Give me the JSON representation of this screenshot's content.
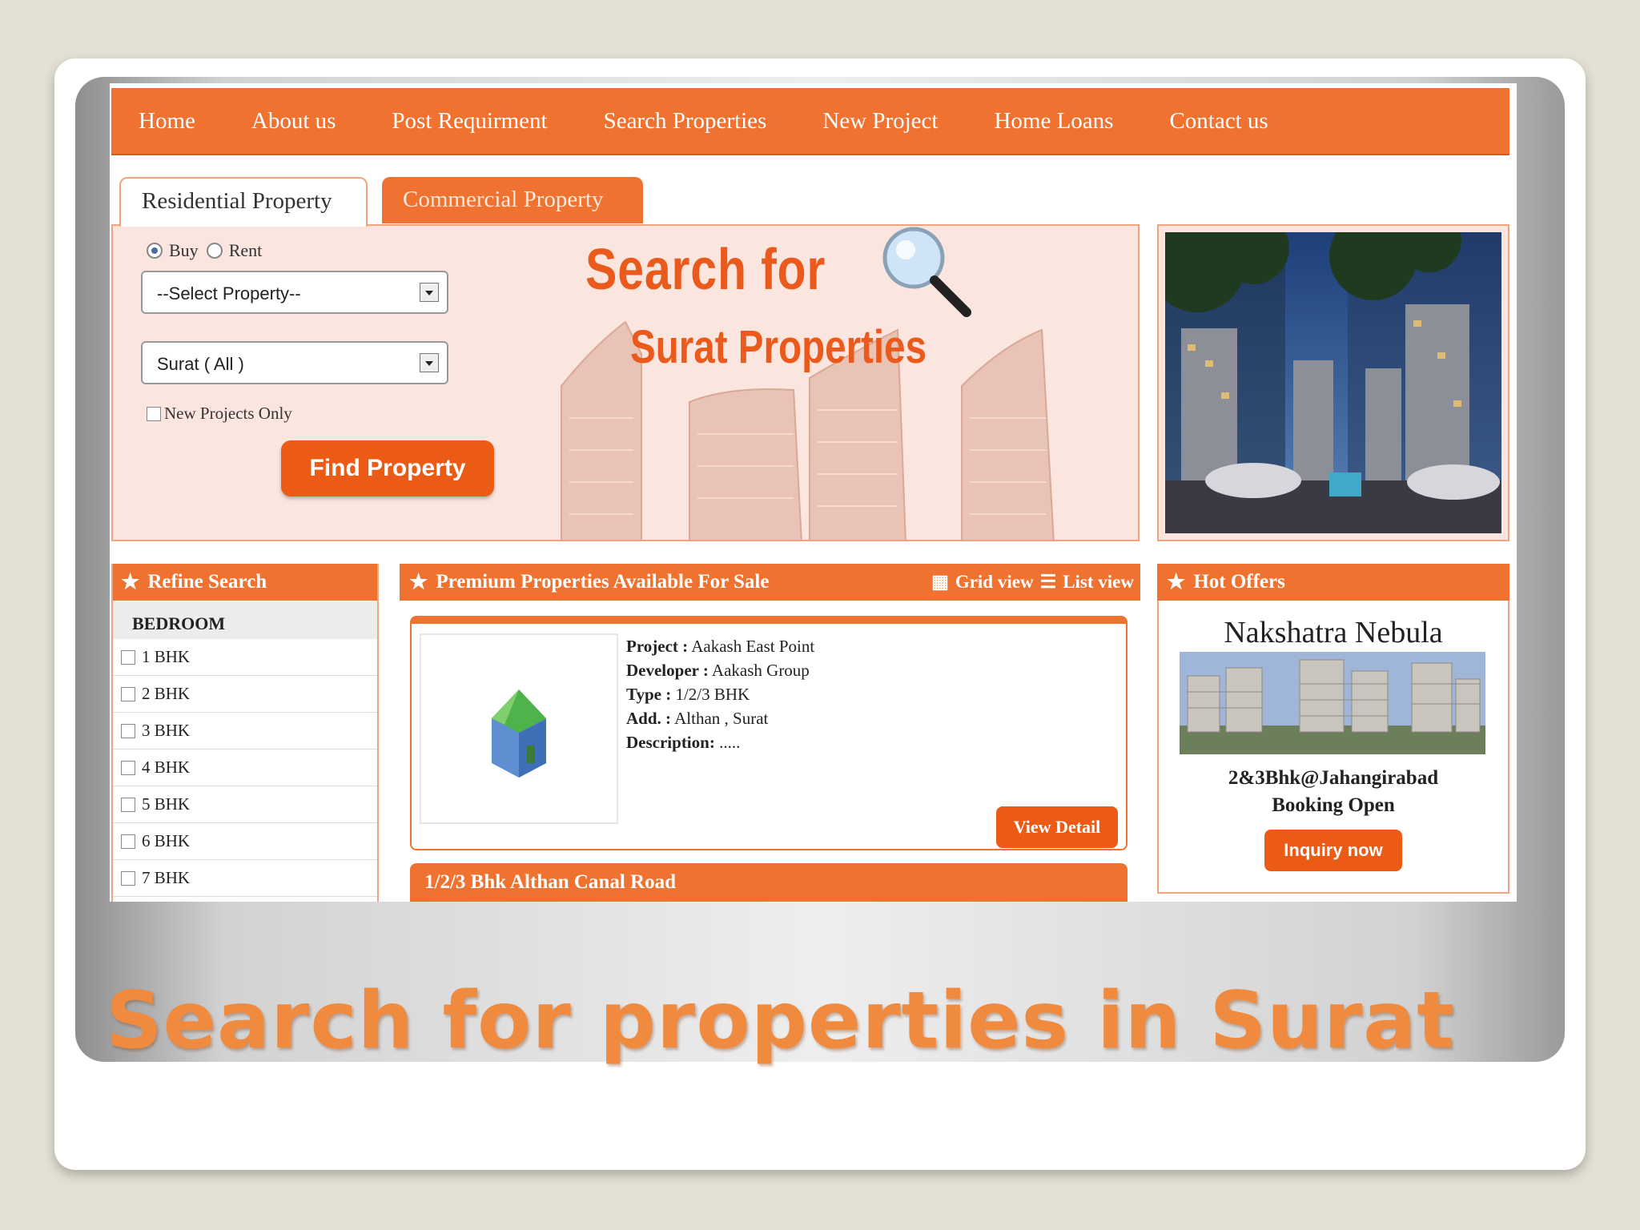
{
  "nav": {
    "items": [
      "Home",
      "About us",
      "Post Requirment",
      "Search Properties",
      "New Project",
      "Home Loans",
      "Contact us"
    ]
  },
  "tabs": {
    "residential": "Residential Property",
    "commercial": "Commercial Property"
  },
  "search": {
    "buy_label": "Buy",
    "rent_label": "Rent",
    "selected_mode": "Buy",
    "property_select": "--Select Property--",
    "city_select": "Surat ( All )",
    "new_projects_label": "New Projects Only",
    "find_button": "Find Property",
    "hero_line1": "Search for",
    "hero_line2": "Surat Properties"
  },
  "refine": {
    "title": "Refine Search",
    "bedroom_header": "BEDROOM",
    "options": [
      "1 BHK",
      "2 BHK",
      "3 BHK",
      "4 BHK",
      "5 BHK",
      "6 BHK",
      "7 BHK"
    ]
  },
  "premium": {
    "title": "Premium Properties Available For Sale",
    "grid_view": "Grid view",
    "list_view": "List view",
    "listing": {
      "project_label": "Project :",
      "project": "Aakash East Point",
      "developer_label": "Developer :",
      "developer": "Aakash Group",
      "type_label": "Type :",
      "type": "1/2/3 BHK",
      "address_label": "Add. :",
      "address": "Althan ,  Surat",
      "description_label": "Description:",
      "description": ".....",
      "view_button": "View Detail"
    },
    "next_listing_title": "1/2/3 Bhk Althan Canal Road"
  },
  "hot_offers": {
    "title": "Hot Offers",
    "project_name": "Nakshatra Nebula",
    "line1": "2&3Bhk@Jahangirabad",
    "line2": "Booking Open",
    "button": "Inquiry now"
  },
  "caption": "Search for properties in Surat",
  "colors": {
    "accent": "#f07230",
    "button": "#ec5b16",
    "panel": "#fbe6df",
    "caption": "#f08a3e"
  }
}
